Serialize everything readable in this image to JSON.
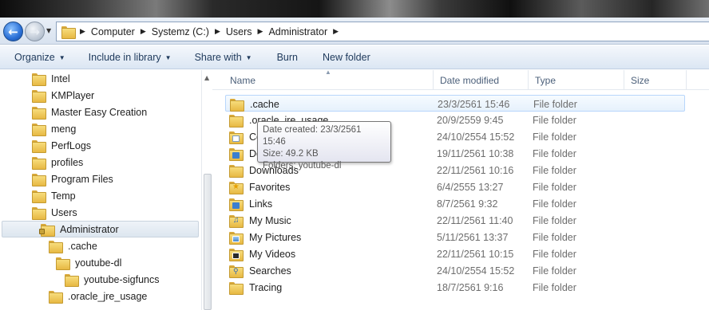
{
  "address_bar": {
    "crumbs": [
      "Computer",
      "Systemz (C:)",
      "Users",
      "Administrator"
    ]
  },
  "toolbar": {
    "organize": "Organize",
    "include_in_library": "Include in library",
    "share_with": "Share with",
    "burn": "Burn",
    "new_folder": "New folder"
  },
  "nav_tree": [
    {
      "label": "Intel"
    },
    {
      "label": "KMPlayer"
    },
    {
      "label": "Master Easy Creation"
    },
    {
      "label": "meng"
    },
    {
      "label": "PerfLogs"
    },
    {
      "label": "profiles"
    },
    {
      "label": "Program Files"
    },
    {
      "label": "Temp"
    },
    {
      "label": "Users"
    },
    {
      "label": "Administrator",
      "selected": true
    },
    {
      "label": ".cache"
    },
    {
      "label": "youtube-dl"
    },
    {
      "label": "youtube-sigfuncs"
    },
    {
      "label": ".oracle_jre_usage"
    }
  ],
  "columns": {
    "name": "Name",
    "date_modified": "Date modified",
    "type": "Type",
    "size": "Size"
  },
  "files": [
    {
      "name": ".cache",
      "date": "23/3/2561 15:46",
      "type": "File folder",
      "icon": "folder-icon"
    },
    {
      "name": ".oracle_jre_usage",
      "date": "20/9/2559 9:45",
      "type": "File folder",
      "icon": "folder-icon"
    },
    {
      "name": "Contacts",
      "date": "24/10/2554 15:52",
      "type": "File folder",
      "icon": "contacts-folder-icon"
    },
    {
      "name": "Desktop",
      "date": "19/11/2561 10:38",
      "type": "File folder",
      "icon": "desktop-folder-icon"
    },
    {
      "name": "Downloads",
      "date": "22/11/2561 10:16",
      "type": "File folder",
      "icon": "downloads-folder-icon"
    },
    {
      "name": "Favorites",
      "date": "6/4/2555 13:27",
      "type": "File folder",
      "icon": "favorites-folder-icon"
    },
    {
      "name": "Links",
      "date": "8/7/2561 9:32",
      "type": "File folder",
      "icon": "links-folder-icon"
    },
    {
      "name": "My Music",
      "date": "22/11/2561 11:40",
      "type": "File folder",
      "icon": "music-folder-icon"
    },
    {
      "name": "My Pictures",
      "date": "5/11/2561 13:37",
      "type": "File folder",
      "icon": "pictures-folder-icon"
    },
    {
      "name": "My Videos",
      "date": "22/11/2561 10:15",
      "type": "File folder",
      "icon": "videos-folder-icon"
    },
    {
      "name": "Searches",
      "date": "24/10/2554 15:52",
      "type": "File folder",
      "icon": "searches-folder-icon"
    },
    {
      "name": "Tracing",
      "date": "18/7/2561 9:16",
      "type": "File folder",
      "icon": "folder-icon"
    }
  ],
  "tooltip": {
    "date_created": "Date created: 23/3/2561 15:46",
    "size": "Size: 49.2 KB",
    "folders": "Folders: youtube-dl"
  },
  "colors": {
    "toolbar_text": "#1e395b",
    "hover_border": "#b8d6fb",
    "folder_yellow": "#e7b843"
  }
}
